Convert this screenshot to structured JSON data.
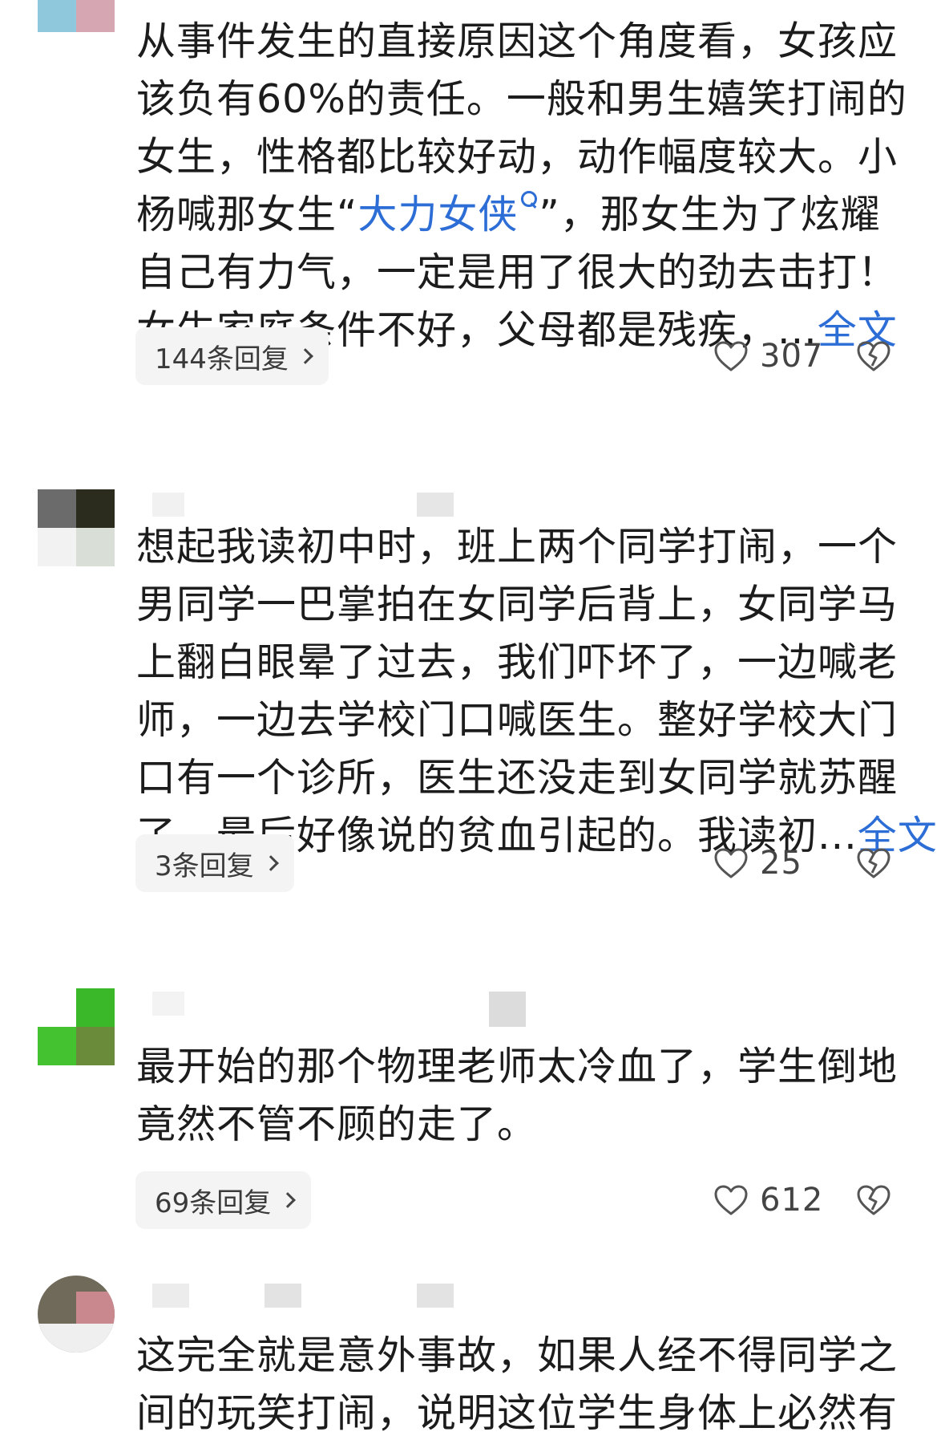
{
  "comments": [
    {
      "lines": [
        "从事件发生的直接原因这个角度看，女孩应",
        "该负有60%的责任。一般和男生嬉笑打闹的",
        "女生，性格都比较好动，动作幅度较大。小"
      ],
      "line4_prefix": "杨喊那女生“",
      "line4_link": "大力女侠",
      "line4_suffix": "”，那女生为了炫耀",
      "line5": "自己有力气，一定是用了很大的劲去击打！",
      "line6": " 女生家庭条件不好，父母都是残疾，...",
      "full_text_label": "全文",
      "reply_label": "144条回复",
      "like_count": "307"
    },
    {
      "lines": [
        "想起我读初中时，班上两个同学打闹，一个",
        "男同学一巴掌拍在女同学后背上，女同学马",
        "上翻白眼晕了过去，我们吓坏了，一边喊老",
        "师，一边去学校门口喊医生。整好学校大门",
        "口有一个诊所，医生还没走到女同学就苏醒"
      ],
      "last_line": "了，最后好像说的贫血引起的。我读初...",
      "full_text_label": "全文",
      "reply_label": "3条回复",
      "like_count": "25"
    },
    {
      "lines": [
        "最开始的那个物理老师太冷血了，学生倒地",
        "竟然不管不顾的走了。"
      ],
      "reply_label": "69条回复",
      "like_count": "612"
    },
    {
      "lines": [
        "这完全就是意外事故，如果人经不得同学之",
        "间的玩笑打闹，说明这位学生身体上必然有"
      ]
    }
  ]
}
